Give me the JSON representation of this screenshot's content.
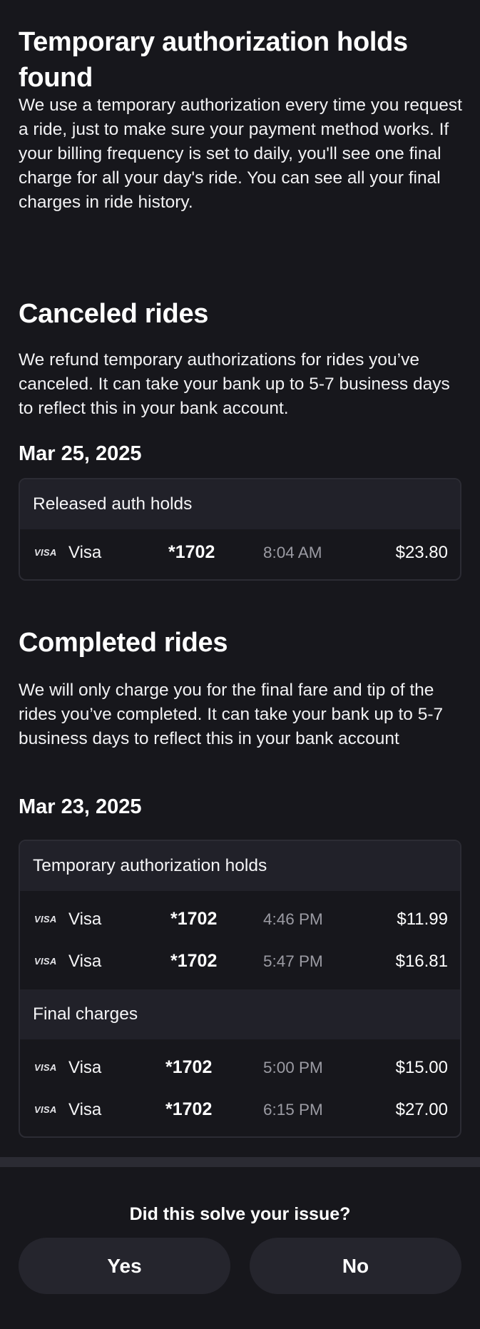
{
  "intro": {
    "title": "Temporary authorization holds found",
    "body": "We use a temporary authorization every time you request a ride, just to make sure your payment method works. If your billing frequency is set to daily, you'll see one final charge for all your day's ride. You can see all your final charges in ride history."
  },
  "canceled": {
    "title": "Canceled rides",
    "body": "We refund temporary authorizations for rides you’ve canceled. It can take your bank up to 5-7 business days to reflect this in your bank account.",
    "date": "Mar 25, 2025",
    "groups": [
      {
        "label": "Released auth holds",
        "rows": [
          {
            "logo": "VISA",
            "card": "Visa",
            "last4": "*1702",
            "time": "8:04 AM",
            "amount": "$23.80"
          }
        ]
      }
    ]
  },
  "completed": {
    "title": "Completed rides",
    "body": "We will only charge you for the final fare and tip of the rides you’ve completed. It can take your bank up to 5-7 business days to reflect this in your bank account",
    "date": "Mar 23, 2025",
    "groups": [
      {
        "label": "Temporary authorization holds",
        "rows": [
          {
            "logo": "VISA",
            "card": "Visa",
            "last4": "*1702",
            "time": "4:46 PM",
            "amount": "$11.99"
          },
          {
            "logo": "VISA",
            "card": "Visa",
            "last4": "*1702",
            "time": "5:47 PM",
            "amount": "$16.81"
          }
        ]
      },
      {
        "label": "Final charges",
        "rows": [
          {
            "logo": "VISA",
            "card": "Visa",
            "last4": "*1702",
            "time": "5:00 PM",
            "amount": "$15.00"
          },
          {
            "logo": "VISA",
            "card": "Visa",
            "last4": "*1702",
            "time": "6:15 PM",
            "amount": "$27.00"
          }
        ]
      }
    ]
  },
  "feedback": {
    "question": "Did this solve your issue?",
    "yes_label": "Yes",
    "no_label": "No"
  },
  "colors": {
    "background": "#17171c",
    "card_header": "#212129",
    "button": "#25252d",
    "muted_text": "#9b9ba3"
  }
}
